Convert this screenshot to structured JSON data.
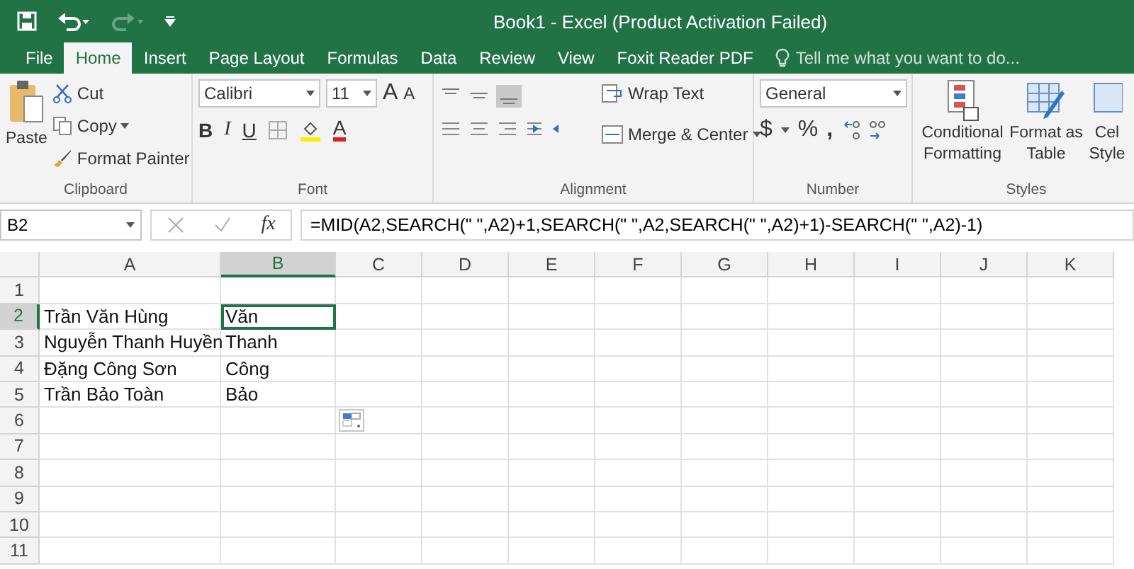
{
  "window": {
    "title": "Book1 - Excel (Product Activation Failed)"
  },
  "tabs": [
    {
      "label": "File",
      "selected": false
    },
    {
      "label": "Home",
      "selected": true
    },
    {
      "label": "Insert",
      "selected": false
    },
    {
      "label": "Page Layout",
      "selected": false
    },
    {
      "label": "Formulas",
      "selected": false
    },
    {
      "label": "Data",
      "selected": false
    },
    {
      "label": "Review",
      "selected": false
    },
    {
      "label": "View",
      "selected": false
    },
    {
      "label": "Foxit Reader PDF",
      "selected": false
    }
  ],
  "tell_me": {
    "placeholder": "Tell me what you want to do..."
  },
  "ribbon": {
    "clipboard": {
      "paste": "Paste",
      "cut": "Cut",
      "copy": "Copy",
      "format_painter": "Format Painter",
      "label": "Clipboard"
    },
    "font": {
      "font_name": "Calibri",
      "font_size": "11",
      "grow": "A",
      "shrink": "A",
      "bold": "B",
      "italic": "I",
      "underline": "U",
      "font_color": "A",
      "label": "Font"
    },
    "alignment": {
      "wrap": "Wrap Text",
      "merge": "Merge & Center",
      "label": "Alignment"
    },
    "number": {
      "format": "General",
      "currency": "$",
      "percent": "%",
      "comma": ",",
      "label": "Number"
    },
    "styles": {
      "buttons": [
        {
          "lines": [
            "Conditional",
            "Formatting"
          ],
          "kind": "conditional"
        },
        {
          "lines": [
            "Format as",
            "Table"
          ],
          "kind": "table"
        },
        {
          "lines": [
            "Cel",
            "Style"
          ],
          "kind": "cell"
        }
      ],
      "label": "Styles"
    }
  },
  "formula_bar": {
    "name_box": "B2",
    "fx": "fx",
    "formula": "=MID(A2,SEARCH(\" \",A2)+1,SEARCH(\" \",A2,SEARCH(\" \",A2)+1)-SEARCH(\" \",A2)-1)"
  },
  "sheet": {
    "columns": [
      {
        "label": "A",
        "selected": false
      },
      {
        "label": "B",
        "selected": true
      },
      {
        "label": "C",
        "selected": false
      },
      {
        "label": "D",
        "selected": false
      },
      {
        "label": "E",
        "selected": false
      },
      {
        "label": "F",
        "selected": false
      },
      {
        "label": "G",
        "selected": false
      },
      {
        "label": "H",
        "selected": false
      },
      {
        "label": "I",
        "selected": false
      },
      {
        "label": "J",
        "selected": false
      },
      {
        "label": "K",
        "selected": false
      }
    ],
    "rows": [
      {
        "number": "1",
        "selected": false,
        "cells": []
      },
      {
        "number": "2",
        "selected": true,
        "cells": [
          "Trần Văn Hùng",
          "Văn"
        ]
      },
      {
        "number": "3",
        "selected": false,
        "cells": [
          "Nguyễn Thanh Huyền",
          "Thanh"
        ]
      },
      {
        "number": "4",
        "selected": false,
        "cells": [
          "Đặng Công Sơn",
          "Công"
        ]
      },
      {
        "number": "5",
        "selected": false,
        "cells": [
          "Trần Bảo Toàn",
          "Bảo"
        ]
      },
      {
        "number": "6",
        "selected": false,
        "cells": []
      },
      {
        "number": "7",
        "selected": false,
        "cells": []
      },
      {
        "number": "8",
        "selected": false,
        "cells": []
      },
      {
        "number": "9",
        "selected": false,
        "cells": []
      },
      {
        "number": "10",
        "selected": false,
        "cells": []
      },
      {
        "number": "11",
        "selected": false,
        "cells": []
      }
    ]
  }
}
